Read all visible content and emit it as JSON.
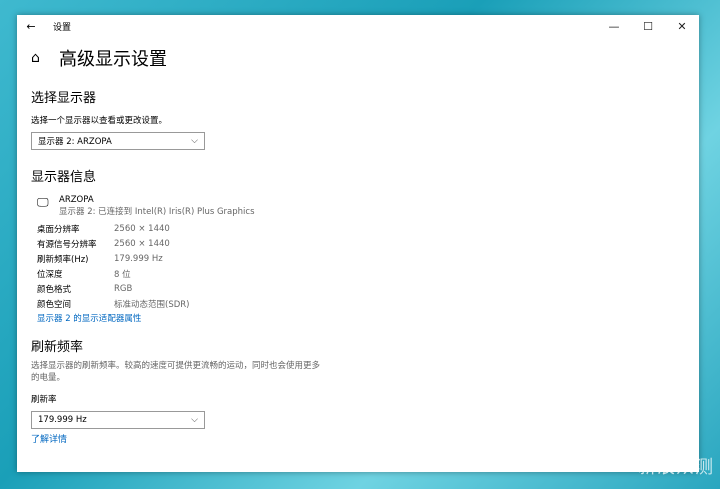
{
  "window": {
    "title": "设置",
    "back": "←",
    "minimize": "—",
    "maximize": "☐",
    "close": "✕"
  },
  "page": {
    "title": "高级显示设置",
    "home_icon": "⌂"
  },
  "select_display": {
    "heading": "选择显示器",
    "label": "选择一个显示器以查看或更改设置。",
    "value": "显示器 2: ARZOPA"
  },
  "display_info": {
    "heading": "显示器信息",
    "monitor_name": "ARZOPA",
    "monitor_sub": "显示器 2: 已连接到 Intel(R) Iris(R) Plus Graphics",
    "rows": [
      {
        "k": "桌面分辨率",
        "v": "2560 × 1440"
      },
      {
        "k": "有源信号分辨率",
        "v": "2560 × 1440"
      },
      {
        "k": "刷新频率(Hz)",
        "v": "179.999 Hz"
      },
      {
        "k": "位深度",
        "v": "8 位"
      },
      {
        "k": "颜色格式",
        "v": "RGB"
      },
      {
        "k": "颜色空间",
        "v": "标准动态范围(SDR)"
      }
    ],
    "adapter_link": "显示器 2 的显示适配器属性"
  },
  "refresh": {
    "heading": "刷新频率",
    "desc": "选择显示器的刷新频率。较高的速度可提供更流畅的运动，同时也会使用更多的电量。",
    "label": "刷新率",
    "value": "179.999 Hz",
    "learn_more": "了解详情"
  },
  "watermark": "新浪众测"
}
